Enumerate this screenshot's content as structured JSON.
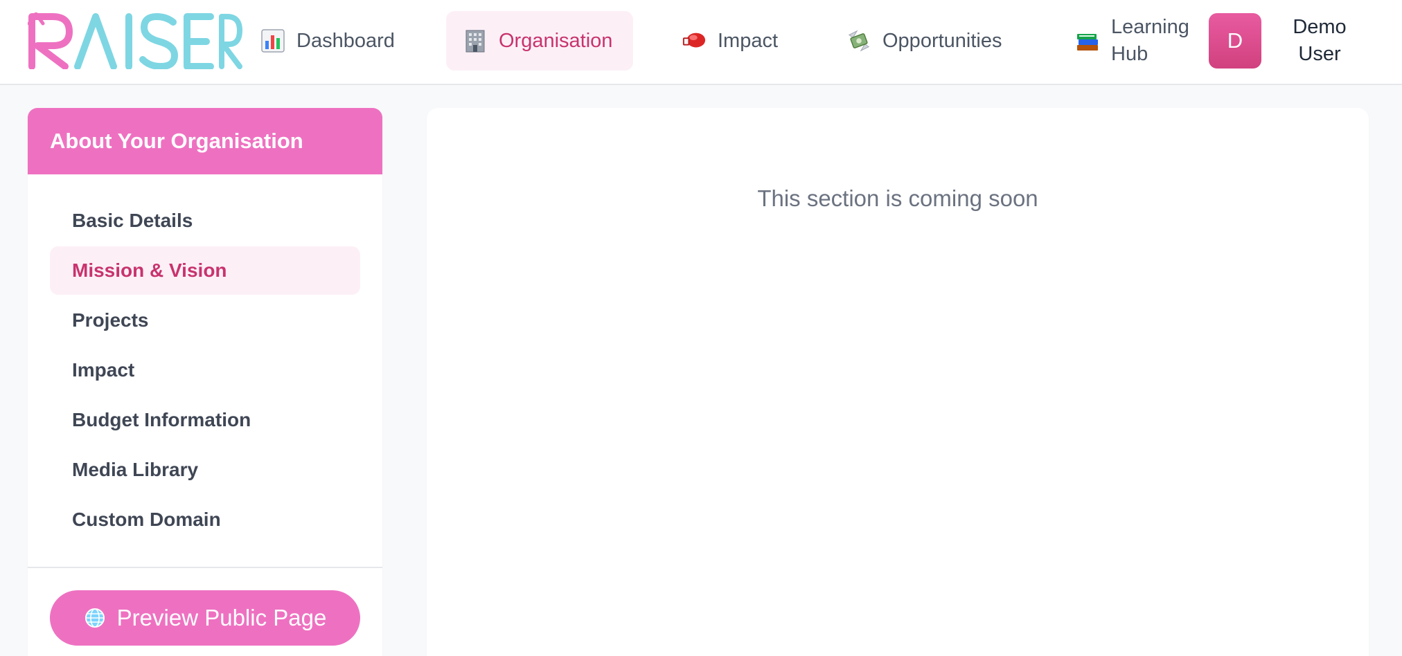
{
  "brand": {
    "logo_text": "RAISER",
    "colors": {
      "pink": "#ee71c1",
      "teal": "#7ed6e3",
      "accent": "#c8336e"
    }
  },
  "nav": {
    "items": [
      {
        "label": "Dashboard",
        "icon": "bar-chart-icon"
      },
      {
        "label": "Organisation",
        "icon": "office-building-icon",
        "active": true
      },
      {
        "label": "Impact",
        "icon": "boxing-glove-icon"
      },
      {
        "label": "Opportunities",
        "icon": "money-wings-icon"
      }
    ],
    "learning": {
      "line1": "Learning",
      "line2": "Hub",
      "icon": "books-icon"
    }
  },
  "user": {
    "initial": "D",
    "name_line1": "Demo",
    "name_line2": "User"
  },
  "sidebar": {
    "title": "About Your Organisation",
    "items": [
      {
        "label": "Basic Details"
      },
      {
        "label": "Mission & Vision",
        "active": true
      },
      {
        "label": "Projects"
      },
      {
        "label": "Impact"
      },
      {
        "label": "Budget Information"
      },
      {
        "label": "Media Library"
      },
      {
        "label": "Custom Domain"
      }
    ],
    "preview_button": {
      "label": "Preview Public Page",
      "icon": "globe-icon"
    }
  },
  "main": {
    "message": "This section is coming soon"
  }
}
